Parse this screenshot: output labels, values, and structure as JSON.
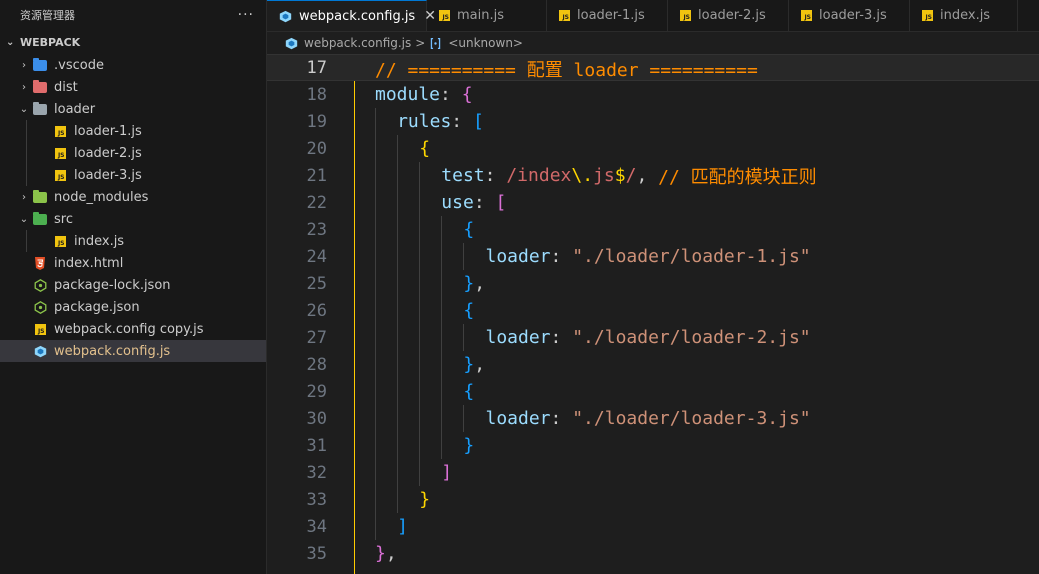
{
  "explorer": {
    "title": "资源管理器",
    "more": "···",
    "section": "WEBPACK",
    "items": [
      {
        "label": ".vscode",
        "kind": "folder",
        "color": "#3b8eea",
        "depth": 0,
        "chev": "›"
      },
      {
        "label": "dist",
        "kind": "folder",
        "color": "#e06c6c",
        "depth": 0,
        "chev": "›"
      },
      {
        "label": "loader",
        "kind": "folder",
        "color": "#9aa5ad",
        "depth": 0,
        "chev": "⌄"
      },
      {
        "label": "loader-1.js",
        "kind": "js",
        "depth": 1
      },
      {
        "label": "loader-2.js",
        "kind": "js",
        "depth": 1
      },
      {
        "label": "loader-3.js",
        "kind": "js",
        "depth": 1
      },
      {
        "label": "node_modules",
        "kind": "folder",
        "color": "#8bc34a",
        "depth": 0,
        "chev": "›"
      },
      {
        "label": "src",
        "kind": "folder",
        "color": "#4caf50",
        "depth": 0,
        "chev": "⌄"
      },
      {
        "label": "index.js",
        "kind": "js",
        "depth": 1
      },
      {
        "label": "index.html",
        "kind": "html",
        "depth": 0
      },
      {
        "label": "package-lock.json",
        "kind": "npm",
        "depth": 0
      },
      {
        "label": "package.json",
        "kind": "npm",
        "depth": 0
      },
      {
        "label": "webpack.config copy.js",
        "kind": "js",
        "depth": 0
      },
      {
        "label": "webpack.config.js",
        "kind": "webpack",
        "depth": 0,
        "selected": true
      }
    ]
  },
  "tabs": [
    {
      "label": "webpack.config.js",
      "icon": "webpack",
      "active": true,
      "close": "✕"
    },
    {
      "label": "main.js",
      "icon": "js",
      "dirty": true
    },
    {
      "label": "loader-1.js",
      "icon": "js"
    },
    {
      "label": "loader-2.js",
      "icon": "js"
    },
    {
      "label": "loader-3.js",
      "icon": "js"
    },
    {
      "label": "index.js",
      "icon": "js"
    }
  ],
  "breadcrumb": {
    "file": "webpack.config.js",
    "sep": ">",
    "symbol": "<unknown>"
  },
  "code": {
    "current_line": 17,
    "lines": [
      {
        "n": "17",
        "indent": 0,
        "tokens": [
          [
            "t-cm",
            "// ========== 配置 loader =========="
          ]
        ]
      },
      {
        "n": "18",
        "indent": 0,
        "tokens": [
          [
            "t-id",
            "module"
          ],
          [
            "t-pl",
            ": "
          ],
          [
            "t-br1",
            "{"
          ]
        ]
      },
      {
        "n": "19",
        "indent": 1,
        "tokens": [
          [
            "t-id",
            "rules"
          ],
          [
            "t-pl",
            ": "
          ],
          [
            "t-br2",
            "["
          ]
        ]
      },
      {
        "n": "20",
        "indent": 2,
        "tokens": [
          [
            "t-br3",
            "{"
          ]
        ]
      },
      {
        "n": "21",
        "indent": 3,
        "tokens": [
          [
            "t-id",
            "test"
          ],
          [
            "t-pl",
            ": "
          ],
          [
            "t-re",
            "/index"
          ],
          [
            "t-res",
            "\\."
          ],
          [
            "t-re",
            "js"
          ],
          [
            "t-res",
            "$"
          ],
          [
            "t-re",
            "/"
          ],
          [
            "t-pl",
            ", "
          ],
          [
            "t-cm",
            "// 匹配的模块正则"
          ]
        ]
      },
      {
        "n": "22",
        "indent": 3,
        "tokens": [
          [
            "t-id",
            "use"
          ],
          [
            "t-pl",
            ": "
          ],
          [
            "t-br1",
            "["
          ]
        ]
      },
      {
        "n": "23",
        "indent": 4,
        "tokens": [
          [
            "t-br2",
            "{"
          ]
        ]
      },
      {
        "n": "24",
        "indent": 5,
        "tokens": [
          [
            "t-id",
            "loader"
          ],
          [
            "t-pl",
            ": "
          ],
          [
            "t-str",
            "\"./loader/loader-1.js\""
          ]
        ]
      },
      {
        "n": "25",
        "indent": 4,
        "tokens": [
          [
            "t-br2",
            "}"
          ],
          [
            "t-pl",
            ","
          ]
        ]
      },
      {
        "n": "26",
        "indent": 4,
        "tokens": [
          [
            "t-br2",
            "{"
          ]
        ]
      },
      {
        "n": "27",
        "indent": 5,
        "tokens": [
          [
            "t-id",
            "loader"
          ],
          [
            "t-pl",
            ": "
          ],
          [
            "t-str",
            "\"./loader/loader-2.js\""
          ]
        ]
      },
      {
        "n": "28",
        "indent": 4,
        "tokens": [
          [
            "t-br2",
            "}"
          ],
          [
            "t-pl",
            ","
          ]
        ]
      },
      {
        "n": "29",
        "indent": 4,
        "tokens": [
          [
            "t-br2",
            "{"
          ]
        ]
      },
      {
        "n": "30",
        "indent": 5,
        "tokens": [
          [
            "t-id",
            "loader"
          ],
          [
            "t-pl",
            ": "
          ],
          [
            "t-str",
            "\"./loader/loader-3.js\""
          ]
        ]
      },
      {
        "n": "31",
        "indent": 4,
        "tokens": [
          [
            "t-br2",
            "}"
          ]
        ]
      },
      {
        "n": "32",
        "indent": 3,
        "tokens": [
          [
            "t-br1",
            "]"
          ]
        ]
      },
      {
        "n": "33",
        "indent": 2,
        "tokens": [
          [
            "t-br3",
            "}"
          ]
        ]
      },
      {
        "n": "34",
        "indent": 1,
        "tokens": [
          [
            "t-br2",
            "]"
          ]
        ]
      },
      {
        "n": "35",
        "indent": 0,
        "tokens": [
          [
            "t-br1",
            "}"
          ],
          [
            "t-pl",
            ","
          ]
        ]
      }
    ]
  }
}
